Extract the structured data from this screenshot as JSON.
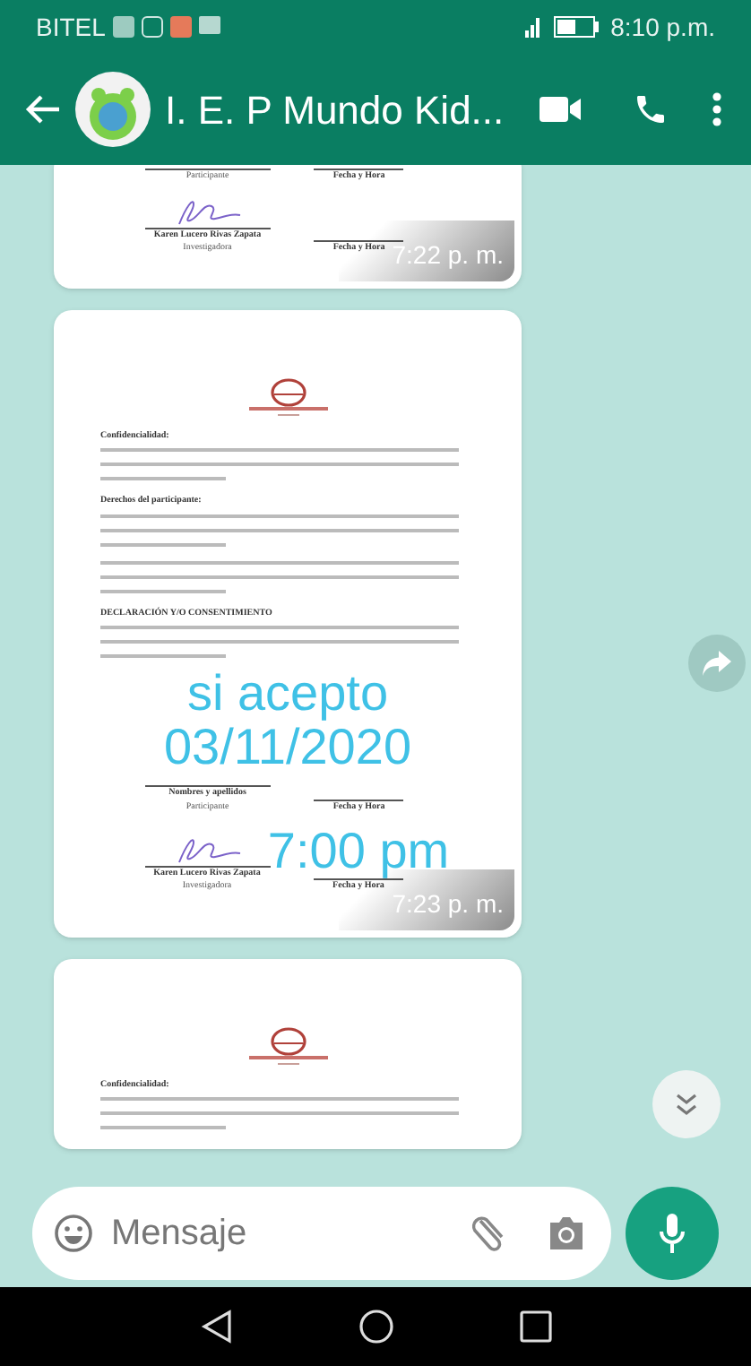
{
  "status_bar": {
    "carrier": "BITEL",
    "time": "8:10 p.m."
  },
  "header": {
    "title": "I. E. P Mundo Kid..."
  },
  "messages": [
    {
      "time": "7:22 p. m.",
      "blocks": [
        {
          "kind": "signature_line",
          "left_role": "Participante",
          "right_label": "Fecha y Hora"
        },
        {
          "kind": "signature",
          "left_name": "Karen Lucero Rivas Zapata",
          "left_role": "Investigadora",
          "right_label": "Fecha y Hora"
        }
      ]
    },
    {
      "time": "7:23 p. m.",
      "blocks": [
        {
          "kind": "logo"
        },
        {
          "kind": "heading",
          "text": "Confidencialidad:"
        },
        {
          "kind": "text_lines"
        },
        {
          "kind": "heading",
          "text": "Derechos del participante:"
        },
        {
          "kind": "text_lines"
        },
        {
          "kind": "text_lines"
        },
        {
          "kind": "heading",
          "text": "DECLARACIÓN Y/O CONSENTIMIENTO"
        },
        {
          "kind": "text_lines"
        },
        {
          "kind": "annotation",
          "text": "si acepto"
        },
        {
          "kind": "annotation",
          "text": "03/11/2020"
        },
        {
          "kind": "signature_line",
          "left_name": "Nombres y apellidos",
          "left_role": "Participante",
          "right_label": "Fecha y Hora"
        },
        {
          "kind": "signature",
          "left_name": "Karen Lucero Rivas Zapata",
          "left_role": "Investigadora",
          "right_label": "Fecha y Hora",
          "annotation": "7:00 pm"
        }
      ]
    },
    {
      "blocks": [
        {
          "kind": "logo"
        },
        {
          "kind": "heading",
          "text": "Confidencialidad:"
        },
        {
          "kind": "text_lines"
        }
      ]
    }
  ],
  "composer": {
    "placeholder": "Mensaje"
  }
}
